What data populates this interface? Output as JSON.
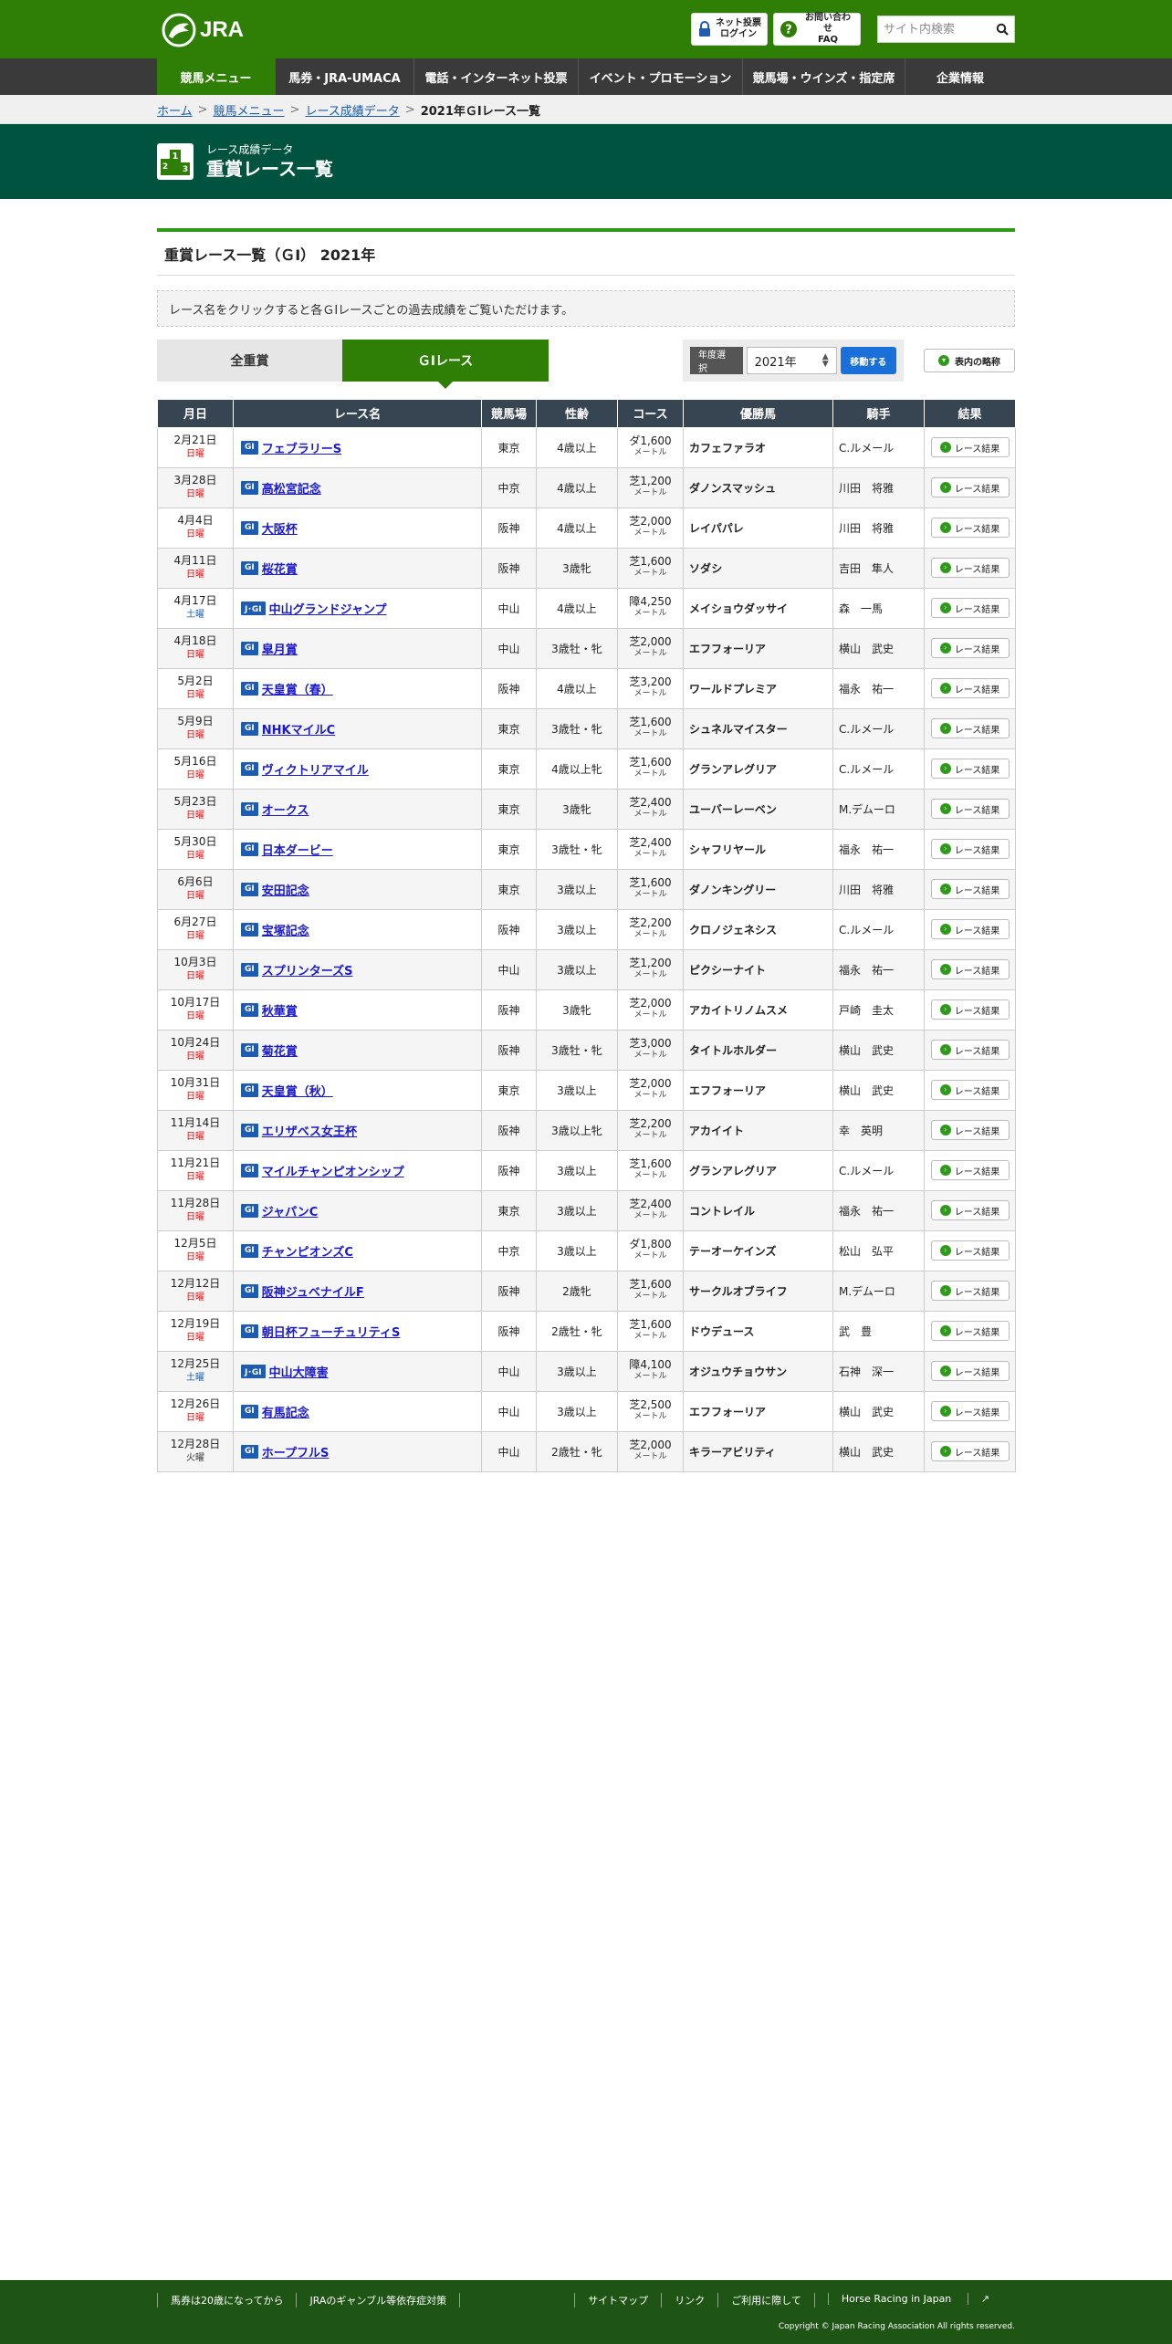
{
  "header": {
    "logo_text": "JRA",
    "vote_label_1": "ネット投票",
    "vote_label_2": "ログイン",
    "faq_label_1": "お問い合わせ",
    "faq_label_2": "FAQ",
    "search_placeholder": "サイト内検索"
  },
  "gnav": [
    {
      "label": "競馬メニュー",
      "current": true
    },
    {
      "label": "馬券・JRA-UMACA"
    },
    {
      "label": "電話・インターネット投票"
    },
    {
      "label": "イベント・プロモーション"
    },
    {
      "label": "競馬場・ウインズ・指定席"
    },
    {
      "label": "企業情報"
    }
  ],
  "breadcrumb": {
    "home": "ホーム",
    "menu": "競馬メニュー",
    "data": "レース成績データ",
    "current": "2021年ＧⅠレース一覧"
  },
  "title": {
    "sub": "レース成績データ",
    "main": "重賞レース一覧"
  },
  "section_heading": "重賞レース一覧（ＧⅠ）  2021年",
  "notice": "レース名をクリックすると各ＧⅠレースごとの過去成績をご覧いただけます。",
  "tabs": {
    "all": "全重賞",
    "g1": "ＧⅠレース"
  },
  "year_select": {
    "label": "年度選択",
    "value": "2021年",
    "go": "移動する"
  },
  "abbr_button": "表内の略称",
  "table": {
    "headers": [
      "月日",
      "レース名",
      "競馬場",
      "性齢",
      "コース",
      "優勝馬",
      "騎手",
      "結果"
    ],
    "result_label": "レース結果",
    "unit": "メートル",
    "rows": [
      {
        "date": "2月21日",
        "dow": "日曜",
        "grade": "GⅠ",
        "name": "フェブラリーS",
        "place": "東京",
        "cond": "4歳以上",
        "course": "ダ1,600",
        "winner": "カフェファラオ",
        "jockey": "C.ルメール"
      },
      {
        "date": "3月28日",
        "dow": "日曜",
        "grade": "GⅠ",
        "name": "高松宮記念",
        "place": "中京",
        "cond": "4歳以上",
        "course": "芝1,200",
        "winner": "ダノンスマッシュ",
        "jockey": "川田　将雅"
      },
      {
        "date": "4月4日",
        "dow": "日曜",
        "grade": "GⅠ",
        "name": "大阪杯",
        "place": "阪神",
        "cond": "4歳以上",
        "course": "芝2,000",
        "winner": "レイパパレ",
        "jockey": "川田　将雅"
      },
      {
        "date": "4月11日",
        "dow": "日曜",
        "grade": "GⅠ",
        "name": "桜花賞",
        "place": "阪神",
        "cond": "3歳牝",
        "course": "芝1,600",
        "winner": "ソダシ",
        "jockey": "吉田　隼人"
      },
      {
        "date": "4月17日",
        "dow": "土曜",
        "grade": "J･GⅠ",
        "name": "中山グランドジャンプ",
        "place": "中山",
        "cond": "4歳以上",
        "course": "障4,250",
        "winner": "メイショウダッサイ",
        "jockey": "森　一馬"
      },
      {
        "date": "4月18日",
        "dow": "日曜",
        "grade": "GⅠ",
        "name": "皐月賞",
        "place": "中山",
        "cond": "3歳牡・牝",
        "course": "芝2,000",
        "winner": "エフフォーリア",
        "jockey": "横山　武史"
      },
      {
        "date": "5月2日",
        "dow": "日曜",
        "grade": "GⅠ",
        "name": "天皇賞（春）",
        "place": "阪神",
        "cond": "4歳以上",
        "course": "芝3,200",
        "winner": "ワールドプレミア",
        "jockey": "福永　祐一"
      },
      {
        "date": "5月9日",
        "dow": "日曜",
        "grade": "GⅠ",
        "name": "NHKマイルC",
        "place": "東京",
        "cond": "3歳牡・牝",
        "course": "芝1,600",
        "winner": "シュネルマイスター",
        "jockey": "C.ルメール"
      },
      {
        "date": "5月16日",
        "dow": "日曜",
        "grade": "GⅠ",
        "name": "ヴィクトリアマイル",
        "place": "東京",
        "cond": "4歳以上牝",
        "course": "芝1,600",
        "winner": "グランアレグリア",
        "jockey": "C.ルメール"
      },
      {
        "date": "5月23日",
        "dow": "日曜",
        "grade": "GⅠ",
        "name": "オークス",
        "place": "東京",
        "cond": "3歳牝",
        "course": "芝2,400",
        "winner": "ユーバーレーベン",
        "jockey": "M.デムーロ"
      },
      {
        "date": "5月30日",
        "dow": "日曜",
        "grade": "GⅠ",
        "name": "日本ダービー",
        "place": "東京",
        "cond": "3歳牡・牝",
        "course": "芝2,400",
        "winner": "シャフリヤール",
        "jockey": "福永　祐一"
      },
      {
        "date": "6月6日",
        "dow": "日曜",
        "grade": "GⅠ",
        "name": "安田記念",
        "place": "東京",
        "cond": "3歳以上",
        "course": "芝1,600",
        "winner": "ダノンキングリー",
        "jockey": "川田　将雅"
      },
      {
        "date": "6月27日",
        "dow": "日曜",
        "grade": "GⅠ",
        "name": "宝塚記念",
        "place": "阪神",
        "cond": "3歳以上",
        "course": "芝2,200",
        "winner": "クロノジェネシス",
        "jockey": "C.ルメール"
      },
      {
        "date": "10月3日",
        "dow": "日曜",
        "grade": "GⅠ",
        "name": "スプリンターズS",
        "place": "中山",
        "cond": "3歳以上",
        "course": "芝1,200",
        "winner": "ピクシーナイト",
        "jockey": "福永　祐一"
      },
      {
        "date": "10月17日",
        "dow": "日曜",
        "grade": "GⅠ",
        "name": "秋華賞",
        "place": "阪神",
        "cond": "3歳牝",
        "course": "芝2,000",
        "winner": "アカイトリノムスメ",
        "jockey": "戸崎　圭太"
      },
      {
        "date": "10月24日",
        "dow": "日曜",
        "grade": "GⅠ",
        "name": "菊花賞",
        "place": "阪神",
        "cond": "3歳牡・牝",
        "course": "芝3,000",
        "winner": "タイトルホルダー",
        "jockey": "横山　武史"
      },
      {
        "date": "10月31日",
        "dow": "日曜",
        "grade": "GⅠ",
        "name": "天皇賞（秋）",
        "place": "東京",
        "cond": "3歳以上",
        "course": "芝2,000",
        "winner": "エフフォーリア",
        "jockey": "横山　武史"
      },
      {
        "date": "11月14日",
        "dow": "日曜",
        "grade": "GⅠ",
        "name": "エリザベス女王杯",
        "place": "阪神",
        "cond": "3歳以上牝",
        "course": "芝2,200",
        "winner": "アカイイト",
        "jockey": "幸　英明"
      },
      {
        "date": "11月21日",
        "dow": "日曜",
        "grade": "GⅠ",
        "name": "マイルチャンピオンシップ",
        "place": "阪神",
        "cond": "3歳以上",
        "course": "芝1,600",
        "winner": "グランアレグリア",
        "jockey": "C.ルメール"
      },
      {
        "date": "11月28日",
        "dow": "日曜",
        "grade": "GⅠ",
        "name": "ジャパンC",
        "place": "東京",
        "cond": "3歳以上",
        "course": "芝2,400",
        "winner": "コントレイル",
        "jockey": "福永　祐一"
      },
      {
        "date": "12月5日",
        "dow": "日曜",
        "grade": "GⅠ",
        "name": "チャンピオンズC",
        "place": "中京",
        "cond": "3歳以上",
        "course": "ダ1,800",
        "winner": "テーオーケインズ",
        "jockey": "松山　弘平"
      },
      {
        "date": "12月12日",
        "dow": "日曜",
        "grade": "GⅠ",
        "name": "阪神ジュベナイルF",
        "place": "阪神",
        "cond": "2歳牝",
        "course": "芝1,600",
        "winner": "サークルオブライフ",
        "jockey": "M.デムーロ"
      },
      {
        "date": "12月19日",
        "dow": "日曜",
        "grade": "GⅠ",
        "name": "朝日杯フューチュリティS",
        "place": "阪神",
        "cond": "2歳牡・牝",
        "course": "芝1,600",
        "winner": "ドウデュース",
        "jockey": "武　豊"
      },
      {
        "date": "12月25日",
        "dow": "土曜",
        "grade": "J･GⅠ",
        "name": "中山大障害",
        "place": "中山",
        "cond": "3歳以上",
        "course": "障4,100",
        "winner": "オジュウチョウサン",
        "jockey": "石神　深一"
      },
      {
        "date": "12月26日",
        "dow": "日曜",
        "grade": "GⅠ",
        "name": "有馬記念",
        "place": "中山",
        "cond": "3歳以上",
        "course": "芝2,500",
        "winner": "エフフォーリア",
        "jockey": "横山　武史"
      },
      {
        "date": "12月28日",
        "dow": "火曜",
        "grade": "GⅠ",
        "name": "ホープフルS",
        "place": "中山",
        "cond": "2歳牡・牝",
        "course": "芝2,000",
        "winner": "キラーアビリティ",
        "jockey": "横山　武史"
      }
    ]
  },
  "footer": {
    "left_links": [
      "馬券は20歳になってから",
      "JRAのギャンブル等依存症対策"
    ],
    "right_links": [
      "サイトマップ",
      "リンク",
      "ご利用に際して",
      "Horse Racing in Japan"
    ],
    "copyright": "Copyright © Japan Racing Association All rights reserved."
  },
  "colors": {
    "brand_green": "#2f7f06",
    "title_bg": "#00533f",
    "table_header": "#374552",
    "grade_blue": "#1f5bb0"
  }
}
